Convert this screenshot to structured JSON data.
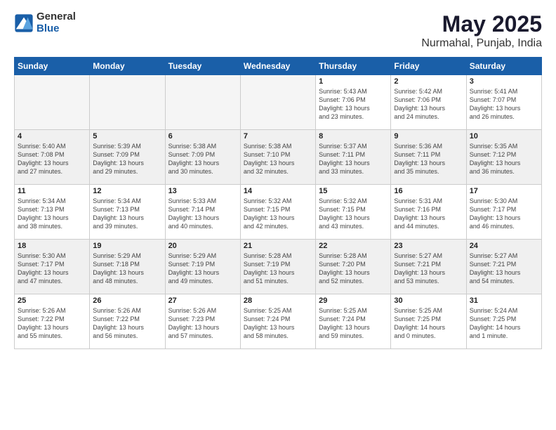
{
  "logo": {
    "general": "General",
    "blue": "Blue"
  },
  "title": {
    "month": "May 2025",
    "location": "Nurmahal, Punjab, India"
  },
  "days_of_week": [
    "Sunday",
    "Monday",
    "Tuesday",
    "Wednesday",
    "Thursday",
    "Friday",
    "Saturday"
  ],
  "weeks": [
    [
      {
        "day": "",
        "info": ""
      },
      {
        "day": "",
        "info": ""
      },
      {
        "day": "",
        "info": ""
      },
      {
        "day": "",
        "info": ""
      },
      {
        "day": "1",
        "info": "Sunrise: 5:43 AM\nSunset: 7:06 PM\nDaylight: 13 hours\nand 23 minutes."
      },
      {
        "day": "2",
        "info": "Sunrise: 5:42 AM\nSunset: 7:06 PM\nDaylight: 13 hours\nand 24 minutes."
      },
      {
        "day": "3",
        "info": "Sunrise: 5:41 AM\nSunset: 7:07 PM\nDaylight: 13 hours\nand 26 minutes."
      }
    ],
    [
      {
        "day": "4",
        "info": "Sunrise: 5:40 AM\nSunset: 7:08 PM\nDaylight: 13 hours\nand 27 minutes."
      },
      {
        "day": "5",
        "info": "Sunrise: 5:39 AM\nSunset: 7:09 PM\nDaylight: 13 hours\nand 29 minutes."
      },
      {
        "day": "6",
        "info": "Sunrise: 5:38 AM\nSunset: 7:09 PM\nDaylight: 13 hours\nand 30 minutes."
      },
      {
        "day": "7",
        "info": "Sunrise: 5:38 AM\nSunset: 7:10 PM\nDaylight: 13 hours\nand 32 minutes."
      },
      {
        "day": "8",
        "info": "Sunrise: 5:37 AM\nSunset: 7:11 PM\nDaylight: 13 hours\nand 33 minutes."
      },
      {
        "day": "9",
        "info": "Sunrise: 5:36 AM\nSunset: 7:11 PM\nDaylight: 13 hours\nand 35 minutes."
      },
      {
        "day": "10",
        "info": "Sunrise: 5:35 AM\nSunset: 7:12 PM\nDaylight: 13 hours\nand 36 minutes."
      }
    ],
    [
      {
        "day": "11",
        "info": "Sunrise: 5:34 AM\nSunset: 7:13 PM\nDaylight: 13 hours\nand 38 minutes."
      },
      {
        "day": "12",
        "info": "Sunrise: 5:34 AM\nSunset: 7:13 PM\nDaylight: 13 hours\nand 39 minutes."
      },
      {
        "day": "13",
        "info": "Sunrise: 5:33 AM\nSunset: 7:14 PM\nDaylight: 13 hours\nand 40 minutes."
      },
      {
        "day": "14",
        "info": "Sunrise: 5:32 AM\nSunset: 7:15 PM\nDaylight: 13 hours\nand 42 minutes."
      },
      {
        "day": "15",
        "info": "Sunrise: 5:32 AM\nSunset: 7:15 PM\nDaylight: 13 hours\nand 43 minutes."
      },
      {
        "day": "16",
        "info": "Sunrise: 5:31 AM\nSunset: 7:16 PM\nDaylight: 13 hours\nand 44 minutes."
      },
      {
        "day": "17",
        "info": "Sunrise: 5:30 AM\nSunset: 7:17 PM\nDaylight: 13 hours\nand 46 minutes."
      }
    ],
    [
      {
        "day": "18",
        "info": "Sunrise: 5:30 AM\nSunset: 7:17 PM\nDaylight: 13 hours\nand 47 minutes."
      },
      {
        "day": "19",
        "info": "Sunrise: 5:29 AM\nSunset: 7:18 PM\nDaylight: 13 hours\nand 48 minutes."
      },
      {
        "day": "20",
        "info": "Sunrise: 5:29 AM\nSunset: 7:19 PM\nDaylight: 13 hours\nand 49 minutes."
      },
      {
        "day": "21",
        "info": "Sunrise: 5:28 AM\nSunset: 7:19 PM\nDaylight: 13 hours\nand 51 minutes."
      },
      {
        "day": "22",
        "info": "Sunrise: 5:28 AM\nSunset: 7:20 PM\nDaylight: 13 hours\nand 52 minutes."
      },
      {
        "day": "23",
        "info": "Sunrise: 5:27 AM\nSunset: 7:21 PM\nDaylight: 13 hours\nand 53 minutes."
      },
      {
        "day": "24",
        "info": "Sunrise: 5:27 AM\nSunset: 7:21 PM\nDaylight: 13 hours\nand 54 minutes."
      }
    ],
    [
      {
        "day": "25",
        "info": "Sunrise: 5:26 AM\nSunset: 7:22 PM\nDaylight: 13 hours\nand 55 minutes."
      },
      {
        "day": "26",
        "info": "Sunrise: 5:26 AM\nSunset: 7:22 PM\nDaylight: 13 hours\nand 56 minutes."
      },
      {
        "day": "27",
        "info": "Sunrise: 5:26 AM\nSunset: 7:23 PM\nDaylight: 13 hours\nand 57 minutes."
      },
      {
        "day": "28",
        "info": "Sunrise: 5:25 AM\nSunset: 7:24 PM\nDaylight: 13 hours\nand 58 minutes."
      },
      {
        "day": "29",
        "info": "Sunrise: 5:25 AM\nSunset: 7:24 PM\nDaylight: 13 hours\nand 59 minutes."
      },
      {
        "day": "30",
        "info": "Sunrise: 5:25 AM\nSunset: 7:25 PM\nDaylight: 14 hours\nand 0 minutes."
      },
      {
        "day": "31",
        "info": "Sunrise: 5:24 AM\nSunset: 7:25 PM\nDaylight: 14 hours\nand 1 minute."
      }
    ]
  ]
}
